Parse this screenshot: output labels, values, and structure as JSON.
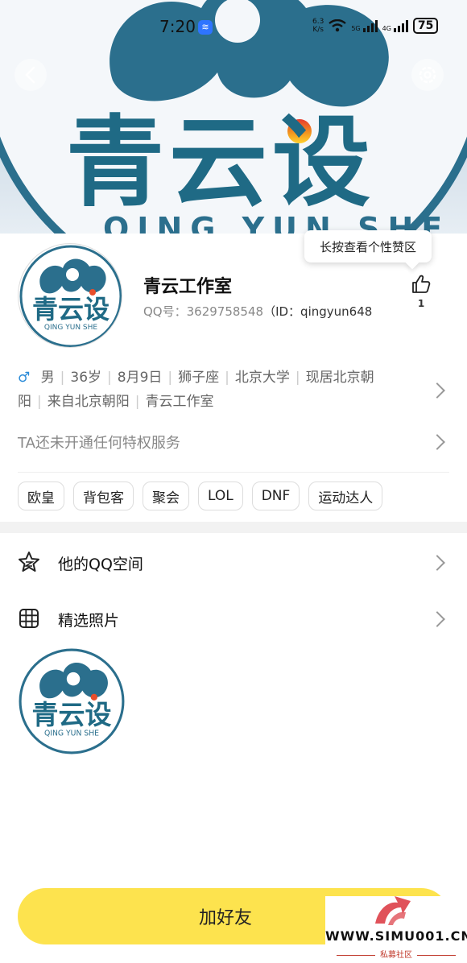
{
  "status_bar": {
    "time": "7:20",
    "net_speed_top": "6.3",
    "net_speed_bottom": "K/s",
    "battery": "75"
  },
  "cover": {
    "title": "青云设",
    "subtitle": "QING YUN SHE"
  },
  "profile": {
    "name": "青云工作室",
    "qq_label": "QQ号：",
    "qq_number": "3629758548",
    "id_label": "（ID：",
    "id_value": "qingyun648",
    "like_tooltip": "长按查看个性赞区",
    "like_count": "1",
    "gender_symbol": "♂",
    "info": [
      "男",
      "36岁",
      "8月9日",
      "狮子座",
      "北京大学",
      "现居北京朝阳",
      "来自北京朝阳",
      "青云工作室"
    ],
    "vip_text": "TA还未开通任何特权服务",
    "tags": [
      "欧皇",
      "背包客",
      "聚会",
      "LOL",
      "DNF",
      "运动达人"
    ]
  },
  "avatar_logo": {
    "title": "青云设",
    "subtitle": "QING YUN SHE"
  },
  "menu": {
    "qzone": "他的QQ空间",
    "photos": "精选照片"
  },
  "actions": {
    "add_friend": "加好友"
  },
  "watermark": {
    "site": "WWW.SIMU001.CN",
    "sub": "私募社区"
  },
  "colors": {
    "accent_yellow": "#fde34e",
    "logo_blue": "#1f6a85",
    "male_blue": "#2b8bd8"
  }
}
